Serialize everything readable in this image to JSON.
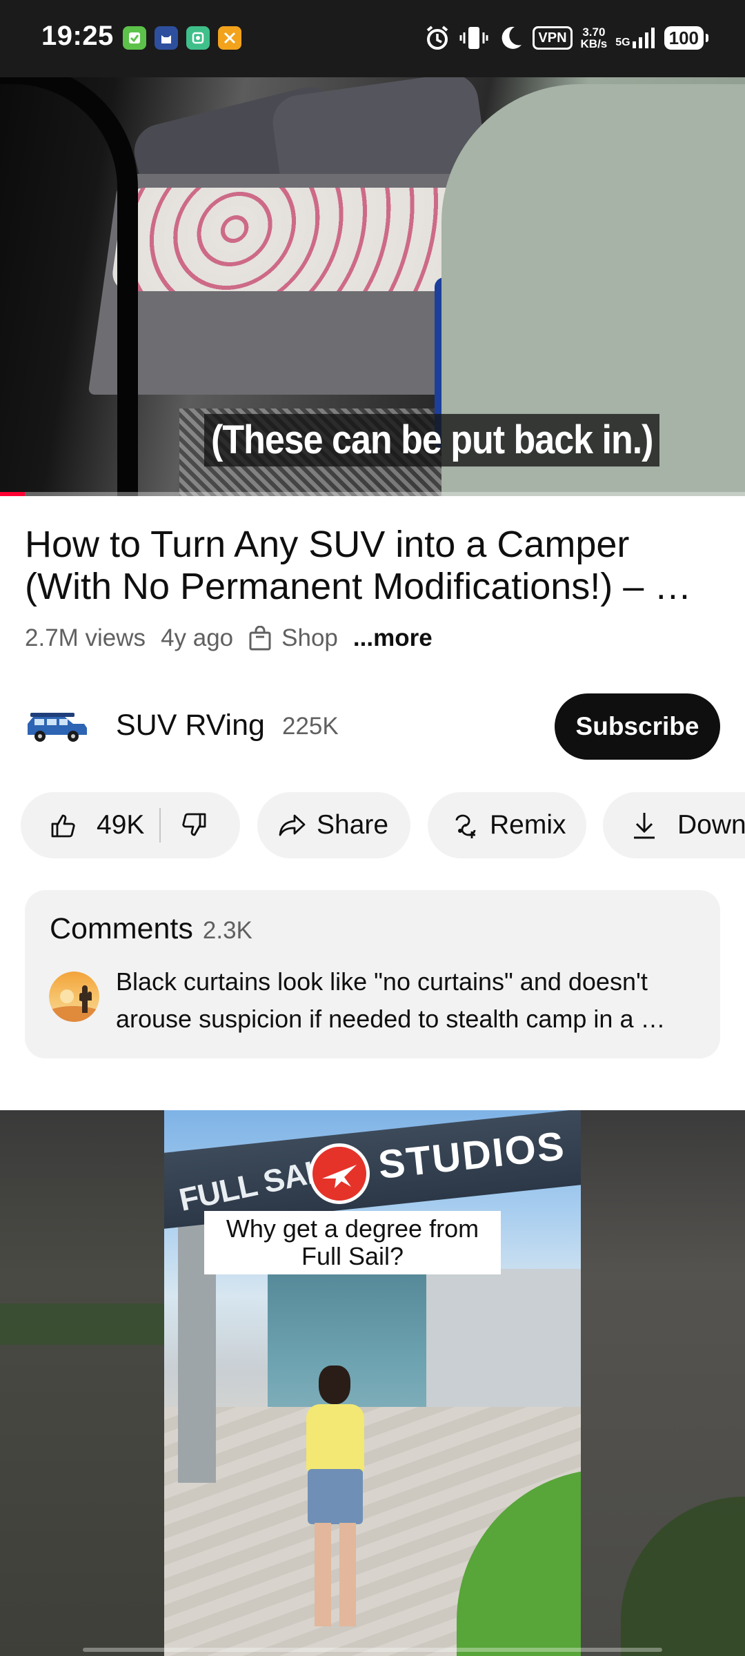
{
  "status_bar": {
    "time": "19:25",
    "vpn": "VPN",
    "net_speed_value": "3.70",
    "net_speed_unit": "KB/s",
    "network": "5G",
    "battery": "100",
    "app_icons": [
      "green-task-icon",
      "cat-app-icon",
      "green-app-icon",
      "orange-tools-icon"
    ]
  },
  "video": {
    "caption": "(These can be put back in.)",
    "progress_fraction": 0.033
  },
  "info": {
    "title": "How to Turn Any SUV into a Camper (With No Permanent Modifications!) – …",
    "views": "2.7M views",
    "age": "4y ago",
    "shop": "Shop",
    "more": "...more"
  },
  "channel": {
    "name": "SUV RVing",
    "subscribers": "225K",
    "subscribe_label": "Subscribe"
  },
  "actions": {
    "likes": "49K",
    "share": "Share",
    "remix": "Remix",
    "download": "Down"
  },
  "comments": {
    "title": "Comments",
    "count": "2.3K",
    "top_comment": "Black  curtains look like \"no curtains\" and doesn't arouse suspicion if needed to stealth camp in a …"
  },
  "next_video": {
    "caption": "Why get a degree from Full Sail?",
    "sign_text": "STUDIOS",
    "sign_text_left": "FULL SAIL"
  },
  "colors": {
    "accent_red": "#ff0033",
    "subscribe_bg": "#0f0f0f",
    "pill_bg": "#f2f2f2"
  }
}
